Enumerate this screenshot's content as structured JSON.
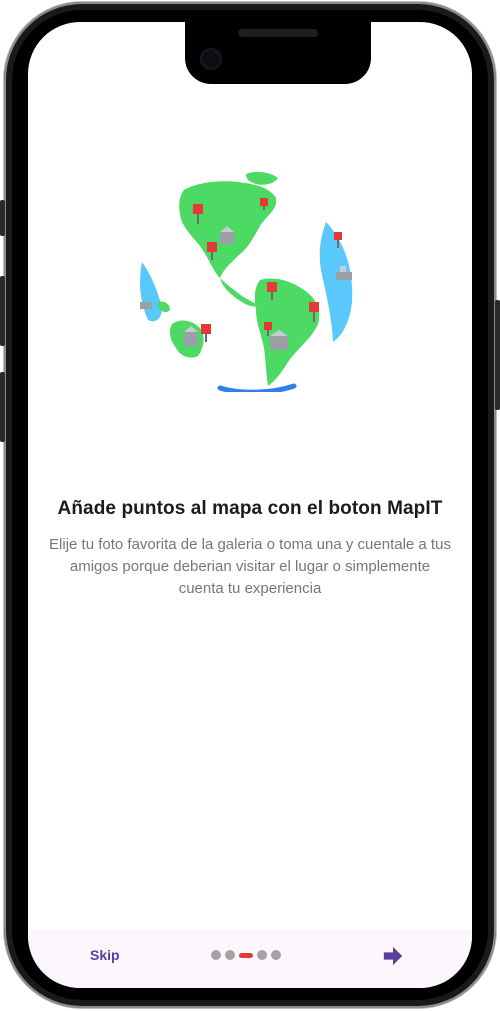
{
  "onboarding": {
    "title": "Añade puntos al mapa con el boton MapIT",
    "description": "Elije tu foto favorita de la galeria o toma una y cuentale a tus amigos porque deberian visitar el lugar o simplemente cuenta tu experiencia"
  },
  "bottom_bar": {
    "skip_label": "Skip",
    "page_count": 5,
    "active_page": 3
  },
  "colors": {
    "accent": "#5b3fa0",
    "active_dot": "#e53935",
    "inactive_dot": "#a3a3a3",
    "land": "#4cd964",
    "ocean_blue": "#5ac8fa"
  },
  "icons": {
    "illustration": "globe-with-pins",
    "next": "arrow-right-icon"
  }
}
